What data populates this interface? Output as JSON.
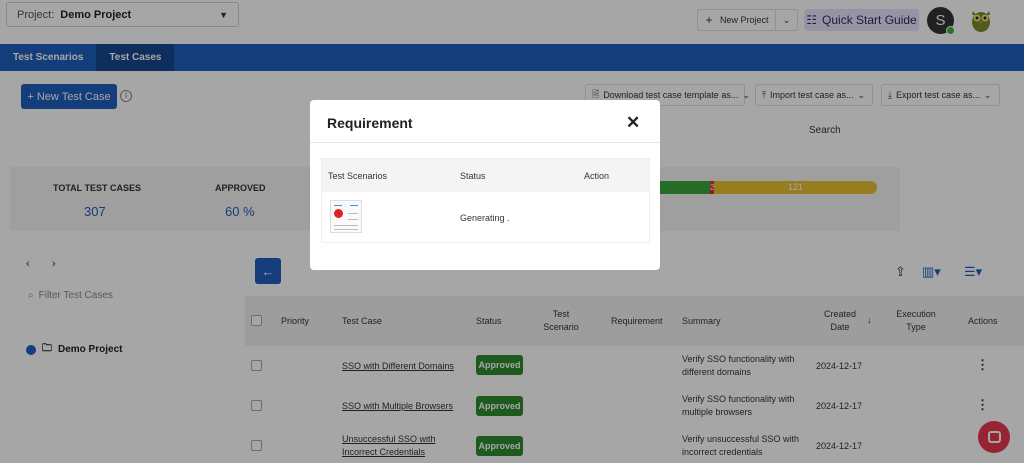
{
  "header": {
    "project_label": "Project:",
    "project_value": "Demo Project",
    "new_project": "New Project",
    "quick_start": "Quick Start Guide",
    "avatar_initial": "S"
  },
  "tabs": [
    {
      "label": "Test Scenarios",
      "active": false
    },
    {
      "label": "Test Cases",
      "active": true
    }
  ],
  "toolbar": {
    "new_test_case": "+ New Test Case",
    "download_template": "Download test case template as...",
    "import": "Import test case as...",
    "export": "Export test case as...",
    "search_label": "Search"
  },
  "stats": {
    "total_label": "TOTAL TEST CASES",
    "total_value": "307",
    "approved_label": "APPROVED",
    "approved_value": "60 %",
    "bar_red": "2",
    "bar_yellow": "121"
  },
  "sidebar": {
    "filter_placeholder": "Filter Test Cases",
    "root_node": "Demo Project"
  },
  "table": {
    "headers": {
      "priority": "Priority",
      "test_case": "Test Case",
      "status": "Status",
      "test_scenario": "Test Scenario",
      "requirement": "Requirement",
      "summary": "Summary",
      "created_date": "Created Date",
      "execution_type": "Execution Type",
      "actions": "Actions"
    },
    "rows": [
      {
        "test_case": "SSO with Different Domains",
        "status": "Approved",
        "summary": "Verify SSO functionality with different domains",
        "created": "2024-12-17"
      },
      {
        "test_case": "SSO with Multiple Browsers",
        "status": "Approved",
        "summary": "Verify SSO functionality with multiple browsers",
        "created": "2024-12-17"
      },
      {
        "test_case": "Unsuccessful SSO with Incorrect Credentials",
        "status": "Approved",
        "summary": "Verify unsuccessful SSO with incorrect credentials",
        "created": "2024-12-17"
      }
    ]
  },
  "modal": {
    "title": "Requirement",
    "col_scenarios": "Test Scenarios",
    "col_status": "Status",
    "col_action": "Action",
    "row_status": "Generating ."
  },
  "colors": {
    "brand_blue": "#1f5fbf",
    "approved_green": "#2f8a2f",
    "bar_yellow": "#e8c030",
    "chat_red": "#e8384f"
  }
}
